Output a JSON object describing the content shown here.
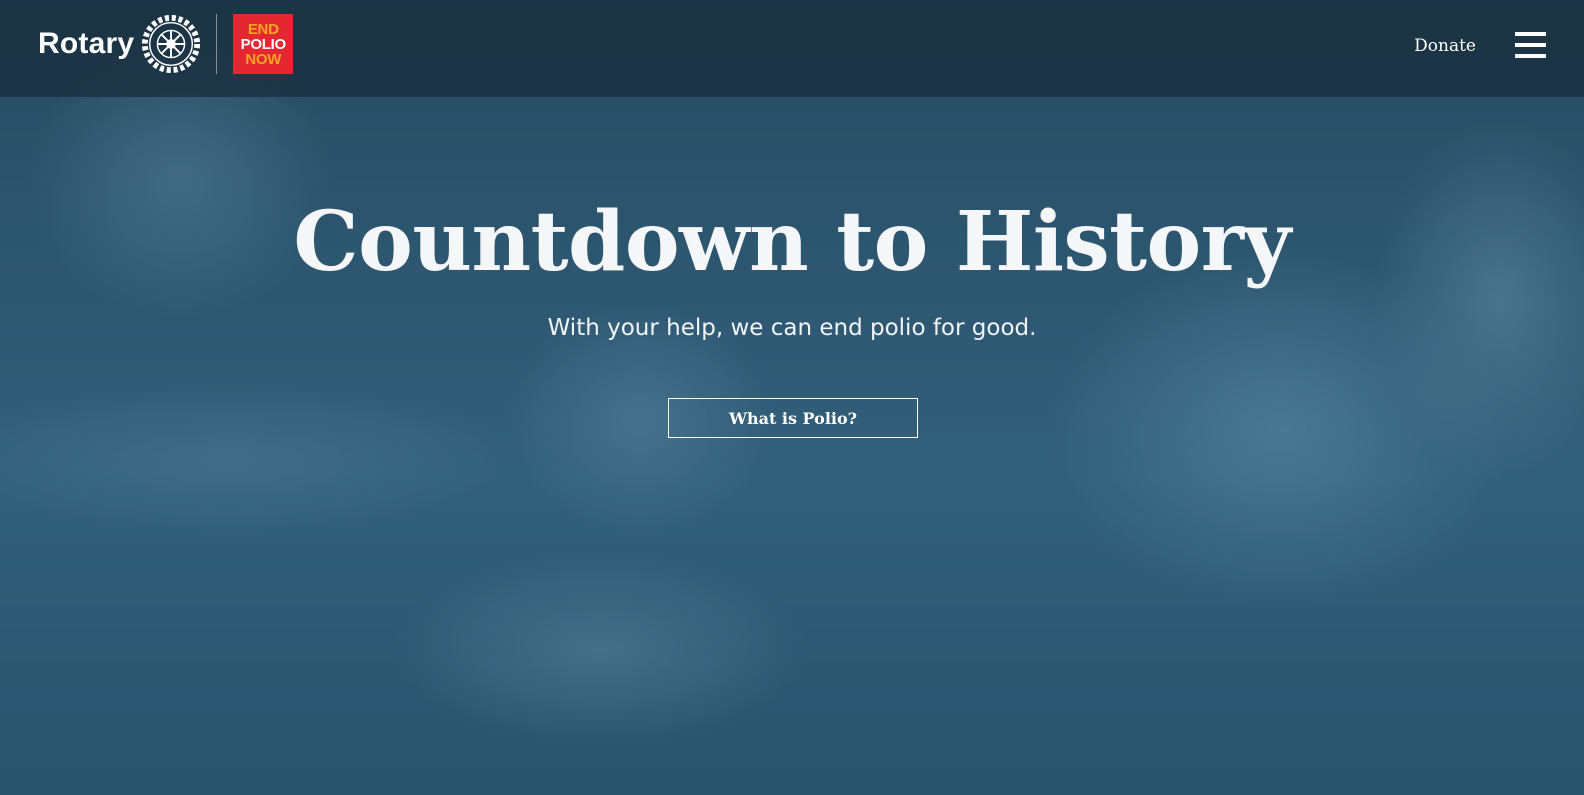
{
  "header": {
    "brand_name": "Rotary",
    "end_polio_logo": {
      "line1": "END",
      "line2": "POLIO",
      "line3": "NOW"
    },
    "donate_label": "Donate",
    "menu_icon": "hamburger-menu-icon"
  },
  "hero": {
    "title": "Countdown to History",
    "subtitle": "With your help, we can end polio for good.",
    "cta_label": "What is Polio?"
  },
  "colors": {
    "overlay_tint": "#2d5670",
    "end_polio_red": "#e42730",
    "end_polio_orange": "#f5a623",
    "text_white": "#ffffff"
  }
}
